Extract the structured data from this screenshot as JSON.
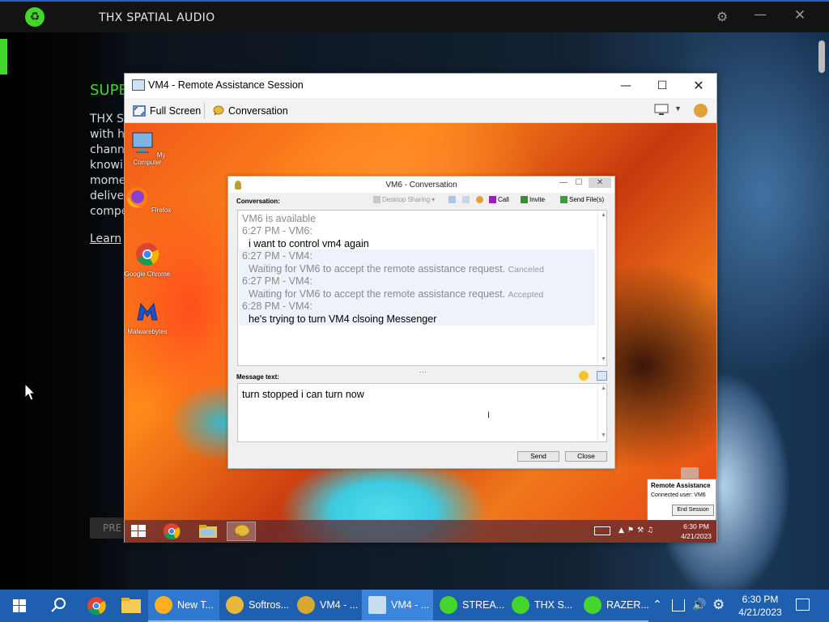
{
  "thx": {
    "title": "THX SPATIAL AUDIO",
    "heading": "SUPE",
    "body_text": "THX S\nwith he\nchann\nknowi\nmome\ndeliver\ncompe",
    "learn_link": "Learn",
    "pre_button": "PRE",
    "accent_color": "#44d62c"
  },
  "ra": {
    "title": "VM4 - Remote Assistance Session",
    "fullscreen_label": "Full Screen",
    "conversation_label": "Conversation"
  },
  "desktop_icons": {
    "my_computer": "My Computer",
    "firefox": "Firefox",
    "chrome": "Google Chrome",
    "malwarebytes": "Malwarebytes"
  },
  "conversation": {
    "title": "VM6 - Conversation",
    "label": "Conversation:",
    "toolbar": {
      "desktop_sharing": "Desktop Sharing",
      "call": "Call",
      "invite": "Invite",
      "send_files": "Send File(s)"
    },
    "messages": [
      {
        "text": "VM6 is available",
        "style": "gray"
      },
      {
        "text": "6:27 PM - VM6:",
        "style": "gray"
      },
      {
        "text": "i want to control vm4 again",
        "style": "black"
      },
      {
        "text": "6:27 PM - VM4:",
        "style": "gray"
      },
      {
        "text": "Waiting for VM6 to accept the remote assistance request.",
        "style": "gray",
        "status": "Canceled"
      },
      {
        "text": "6:27 PM - VM4:",
        "style": "gray"
      },
      {
        "text": "Waiting for VM6 to accept the remote assistance request.",
        "style": "gray",
        "status": "Accepted"
      },
      {
        "text": "6:28 PM - VM4:",
        "style": "gray"
      },
      {
        "text": "he's trying to turn VM4 clsoing Messenger",
        "style": "black"
      }
    ],
    "message_label": "Message text:",
    "input_value": "turn stopped i can turn now",
    "send_label": "Send",
    "close_label": "Close"
  },
  "remote_assistance": {
    "title": "Remote Assistance",
    "connected_user": "Connected user:  VM6",
    "end_session": "End Session"
  },
  "remote_taskbar": {
    "time": "6:30 PM",
    "date": "4/21/2023"
  },
  "taskbar": {
    "apps": [
      "New T...",
      "Softros...",
      "VM4 - ...",
      "VM4 - ...",
      "STREA...",
      "THX S...",
      "RAZER..."
    ],
    "time": "6:30 PM",
    "date": "4/21/2023"
  }
}
